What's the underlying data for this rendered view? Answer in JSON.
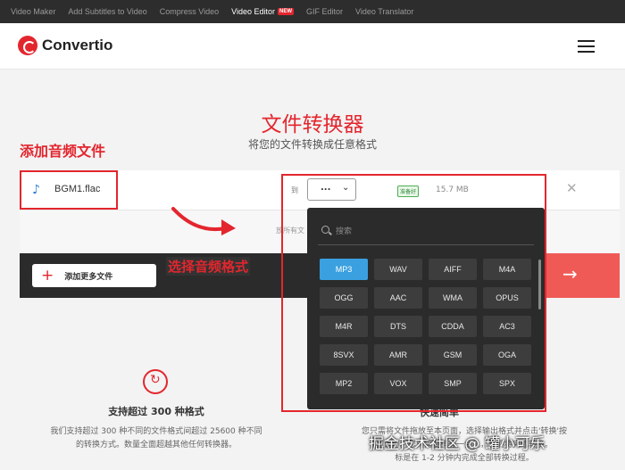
{
  "topnav": {
    "items": [
      "Video Maker",
      "Add Subtitles to Video",
      "Compress Video",
      "Video Editor",
      "GIF Editor",
      "Video Translator"
    ],
    "new_badge": "NEW"
  },
  "header": {
    "logo_text": "Convertio"
  },
  "hero": {
    "title": "文件转换器",
    "subtitle": "将您的文件转换成任意格式"
  },
  "annotations": {
    "add_audio": "添加音频文件",
    "select_format": "选择音频格式"
  },
  "file": {
    "name": "BGM1.flac",
    "to_label": "到",
    "selected_format": "...",
    "status": "准备好",
    "size": "15.7 MB"
  },
  "dropzone": {
    "text": "放所有文"
  },
  "actions": {
    "add_more_label": "添加更多文件"
  },
  "dropdown": {
    "search_placeholder": "搜索",
    "formats": [
      "MP3",
      "WAV",
      "AIFF",
      "M4A",
      "OGG",
      "AAC",
      "WMA",
      "OPUS",
      "M4R",
      "DTS",
      "CDDA",
      "AC3",
      "8SVX",
      "AMR",
      "GSM",
      "OGA",
      "MP2",
      "VOX",
      "SMP",
      "SPX"
    ],
    "selected": "MP3"
  },
  "features": {
    "f1_title": "支持超过 300 种格式",
    "f1_desc_1": "我们支持超过 300 种不同的文件格式间超过 25600 种不同",
    "f1_desc_2": "的转换方式。数量全面超越其他任何转换器。",
    "f2_title": "快速简单",
    "f2_desc_1": "您只需将文件拖放至本页面，选择输出格式并点击'转换'按",
    "f2_desc_2": "钮即可。您只需要稍等一会儿，我们将完成转换。",
    "f2_desc_3": "标是在 1-2 分钟内完成全部转换过程。"
  },
  "watermark": "掘金技术社区 @ 罐小可乐",
  "colors": {
    "brand_red": "#e3262e",
    "selected_blue": "#3aa0e0",
    "dark_panel": "#2b2b2b"
  }
}
